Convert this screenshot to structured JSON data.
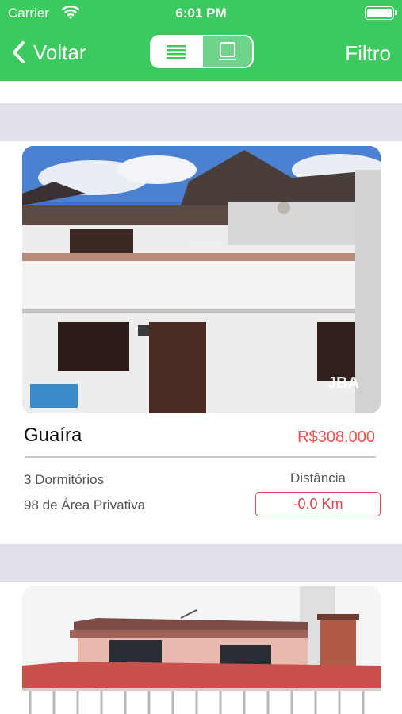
{
  "status_bar": {
    "carrier": "Carrier",
    "time": "6:01 PM"
  },
  "nav": {
    "back_label": "Voltar",
    "filter_label": "Filtro",
    "view_toggle": {
      "list_icon": "list-icon",
      "card_icon": "card-icon",
      "selected": "list"
    }
  },
  "colors": {
    "header": "#3cc95d",
    "price": "#f0534d",
    "separator": "#e1e1eb"
  },
  "listings": [
    {
      "title": "Guaíra",
      "price": "R$308.000",
      "bedrooms": "3 Dormitórios",
      "area": "98 de Área Privativa",
      "distance_label": "Distância",
      "distance": "-0.0 Km",
      "watermark": "JBA"
    },
    {
      "title": "",
      "price": ""
    }
  ]
}
